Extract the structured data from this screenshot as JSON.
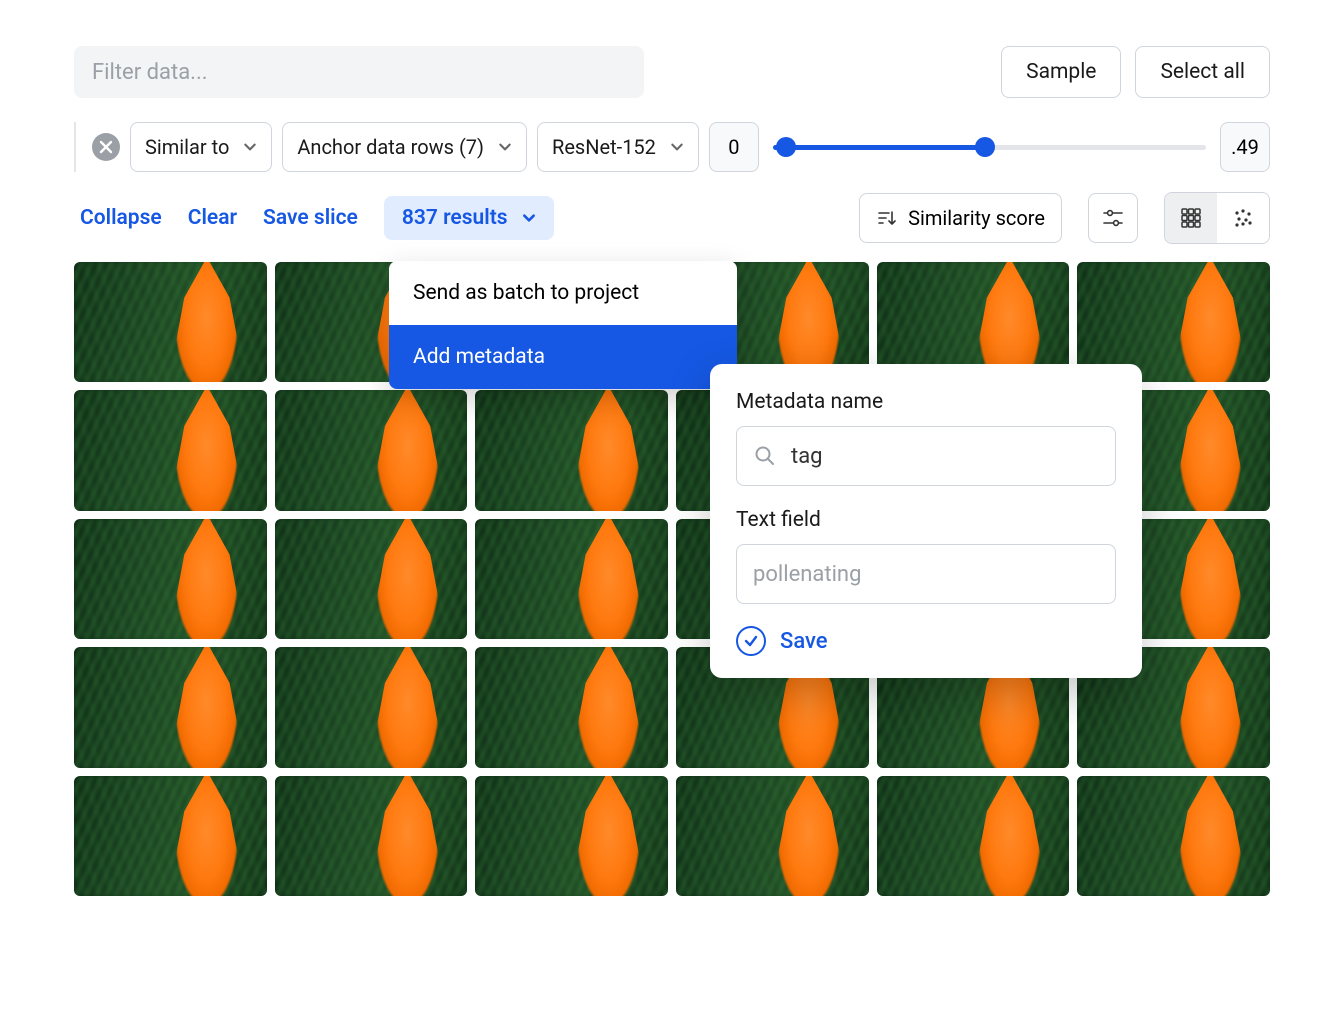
{
  "toolbar": {
    "filter_placeholder": "Filter data...",
    "sample_label": "Sample",
    "select_all_label": "Select all"
  },
  "filters": {
    "similar_to": "Similar to",
    "anchor_rows": "Anchor data rows (7)",
    "model": "ResNet-152",
    "range_min": "0",
    "range_max": ".49",
    "slider_fill_pct": 49
  },
  "actions": {
    "collapse": "Collapse",
    "clear": "Clear",
    "save_slice": "Save slice",
    "results": "837 results",
    "sort_label": "Similarity score"
  },
  "dropdown": {
    "items": [
      {
        "label": "Send as batch to project",
        "selected": false
      },
      {
        "label": "Add metadata",
        "selected": true
      }
    ]
  },
  "metadata_popover": {
    "name_label": "Metadata name",
    "name_value": "tag",
    "text_label": "Text field",
    "text_placeholder": "pollenating",
    "save_label": "Save"
  },
  "grid": {
    "rows": 5,
    "cols": 6
  }
}
